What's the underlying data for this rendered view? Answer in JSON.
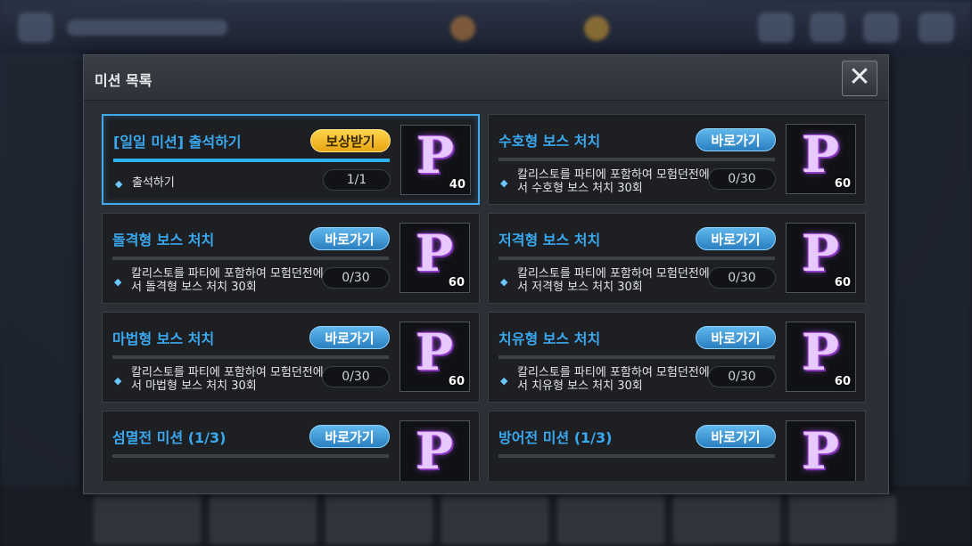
{
  "modal": {
    "title": "미션 목록",
    "close_symbol": "✕"
  },
  "missions": [
    {
      "title": "[일일 미션] 출석하기",
      "button": "보상받기",
      "button_type": "claim",
      "desc": "출석하기",
      "progress": "1/1",
      "progress_fraction": 1.0,
      "reward": "40",
      "active": true
    },
    {
      "title": "수호형 보스 처치",
      "button": "바로가기",
      "button_type": "go",
      "desc": "칼리스토를 파티에 포함하여 모험던전에서 수호형 보스 처치 30회",
      "progress": "0/30",
      "progress_fraction": 0.0,
      "reward": "60"
    },
    {
      "title": "돌격형 보스 처치",
      "button": "바로가기",
      "button_type": "go",
      "desc": "칼리스토를 파티에 포함하여 모험던전에서 돌격형 보스 처치 30회",
      "progress": "0/30",
      "progress_fraction": 0.0,
      "reward": "60"
    },
    {
      "title": "저격형 보스 처치",
      "button": "바로가기",
      "button_type": "go",
      "desc": "칼리스토를 파티에 포함하여 모험던전에서 저격형 보스 처치 30회",
      "progress": "0/30",
      "progress_fraction": 0.0,
      "reward": "60"
    },
    {
      "title": "마법형 보스 처치",
      "button": "바로가기",
      "button_type": "go",
      "desc": "칼리스토를 파티에 포함하여 모험던전에서 마법형 보스 처치 30회",
      "progress": "0/30",
      "progress_fraction": 0.0,
      "reward": "60"
    },
    {
      "title": "치유형 보스 처치",
      "button": "바로가기",
      "button_type": "go",
      "desc": "칼리스토를 파티에 포함하여 모험던전에서 치유형 보스 처치 30회",
      "progress": "0/30",
      "progress_fraction": 0.0,
      "reward": "60"
    },
    {
      "title": "섬멸전 미션 (1/3)",
      "button": "바로가기",
      "button_type": "go",
      "desc": "",
      "progress": "",
      "progress_fraction": 0.0,
      "reward": ""
    },
    {
      "title": "방어전 미션 (1/3)",
      "button": "바로가기",
      "button_type": "go",
      "desc": "",
      "progress": "",
      "progress_fraction": 0.0,
      "reward": ""
    }
  ],
  "reward_icon": {
    "glyph": "P",
    "name": "p-point-icon"
  },
  "colors": {
    "accent_blue": "#3aa8ee",
    "claim_gold": "#f5c02a",
    "panel_bg": "#2c2f35"
  }
}
